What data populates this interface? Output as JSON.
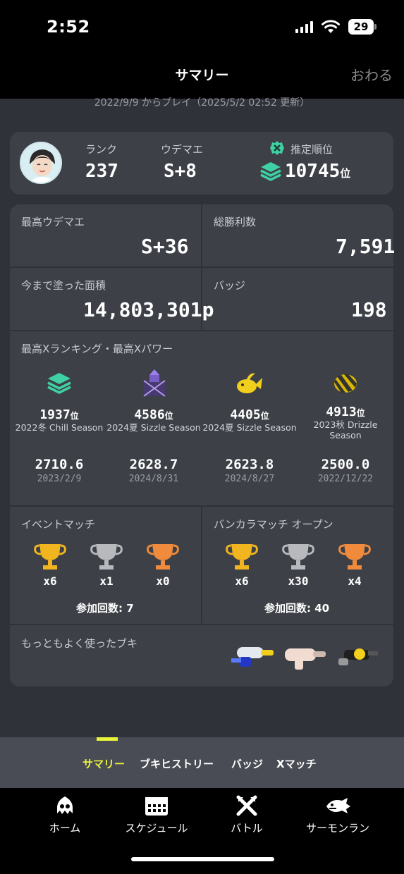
{
  "status": {
    "time": "2:52",
    "battery": "29"
  },
  "header": {
    "title": "サマリー",
    "close": "おわる"
  },
  "subtitle": "2022/9/9 からプレイ（2025/5/2 02:52 更新）",
  "profile": {
    "rank_label": "ランク",
    "rank": "237",
    "udemae_label": "ウデマエ",
    "udemae": "S+8",
    "est_label": "推定順位",
    "est_rank": "10745",
    "est_suffix": "位"
  },
  "stats": {
    "max_udemae_label": "最高ウデマエ",
    "max_udemae": "S+36",
    "wins_label": "総勝利数",
    "wins": "7,591",
    "paint_label": "今まで塗った面積",
    "paint": "14,803,301p",
    "badge_label": "バッジ",
    "badges": "198"
  },
  "x_section": {
    "label": "最高Xランキング・最高Xパワー",
    "items": [
      {
        "rank": "1937",
        "suffix": "位",
        "season": "2022冬 Chill Season",
        "power": "2710.6",
        "date": "2023/2/9"
      },
      {
        "rank": "4586",
        "suffix": "位",
        "season": "2024夏 Sizzle Season",
        "power": "2628.7",
        "date": "2024/8/31"
      },
      {
        "rank": "4405",
        "suffix": "位",
        "season": "2024夏 Sizzle Season",
        "power": "2623.8",
        "date": "2024/8/27"
      },
      {
        "rank": "4913",
        "suffix": "位",
        "season": "2023秋 Drizzle Season",
        "power": "2500.0",
        "date": "2022/12/22"
      }
    ]
  },
  "event_match": {
    "label": "イベントマッチ",
    "counts": [
      "x6",
      "x1",
      "x0"
    ],
    "participation": "参加回数: 7"
  },
  "bankara_open": {
    "label": "バンカラマッチ オープン",
    "counts": [
      "x6",
      "x30",
      "x4"
    ],
    "participation": "参加回数: 40"
  },
  "weapons": {
    "label": "もっともよく使ったブキ"
  },
  "subtabs": [
    "サマリー",
    "ブキヒストリー",
    "バッジ",
    "Xマッチ"
  ],
  "nav": [
    "ホーム",
    "スケジュール",
    "バトル",
    "サーモンラン"
  ],
  "colors": {
    "accent": "#e9f23a",
    "card": "#3d4047",
    "bg": "#2f3238"
  }
}
